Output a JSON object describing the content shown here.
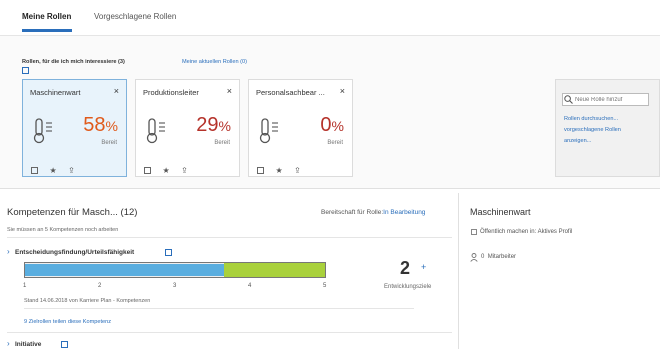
{
  "tabs": [
    "Meine Rollen",
    "Vorgeschlagene Rollen"
  ],
  "roles_header": {
    "label": "Rollen, für die ich mich interessiere (3)",
    "current_link": "Meine aktuellen Rollen (0)"
  },
  "cards": [
    {
      "title": "Maschinenwart",
      "percent": "58",
      "percent_symbol": "%",
      "ready": "Bereit",
      "color": "#e05a1b",
      "selected": true
    },
    {
      "title": "Produktionsleiter",
      "percent": "29",
      "percent_symbol": "%",
      "ready": "Bereit",
      "color": "#b5322a",
      "selected": false
    },
    {
      "title": "Personalsachbear ...",
      "percent": "0",
      "percent_symbol": "%",
      "ready": "Bereit",
      "color": "#b5322a",
      "selected": false
    }
  ],
  "card_close_glyph": "×",
  "search": {
    "placeholder": "Neue Rolle hinzuf",
    "links": [
      "Rollen durchsuchen...",
      "vorgeschlagene Rollen",
      "anzeigen..."
    ]
  },
  "competencies": {
    "title": "Kompetenzen für Masch... (12)",
    "readiness_prefix": "Bereitschaft für Rolle:",
    "readiness_link": "In Bearbeitung",
    "note": "Sie müssen an 5 Kompetenzen noch arbeiten",
    "items": [
      {
        "name": "Entscheidungsfindung/Urteilsfähigkeit",
        "current_level": 3,
        "target_level": 5,
        "scale": [
          "1",
          "2",
          "3",
          "4",
          "5"
        ],
        "dev_count": "2",
        "dev_plus": "+",
        "dev_label": "Entwicklungsziele",
        "status": "Stand 14.06.2018 von Karriere Plan - Kompetenzen",
        "targets_link": "9 Zielrollen teilen diese Kompetenz"
      },
      {
        "name": "Initiative"
      }
    ]
  },
  "right_panel": {
    "title": "Maschinenwart",
    "checkbox_label": "Öffentlich machen in: Aktives Profil",
    "members_count": "0",
    "members_label": "Mitarbeiter"
  },
  "colors": {
    "accent": "#2a6ebb",
    "bar_current": "#5aaee0",
    "bar_target": "#a9d13c"
  }
}
